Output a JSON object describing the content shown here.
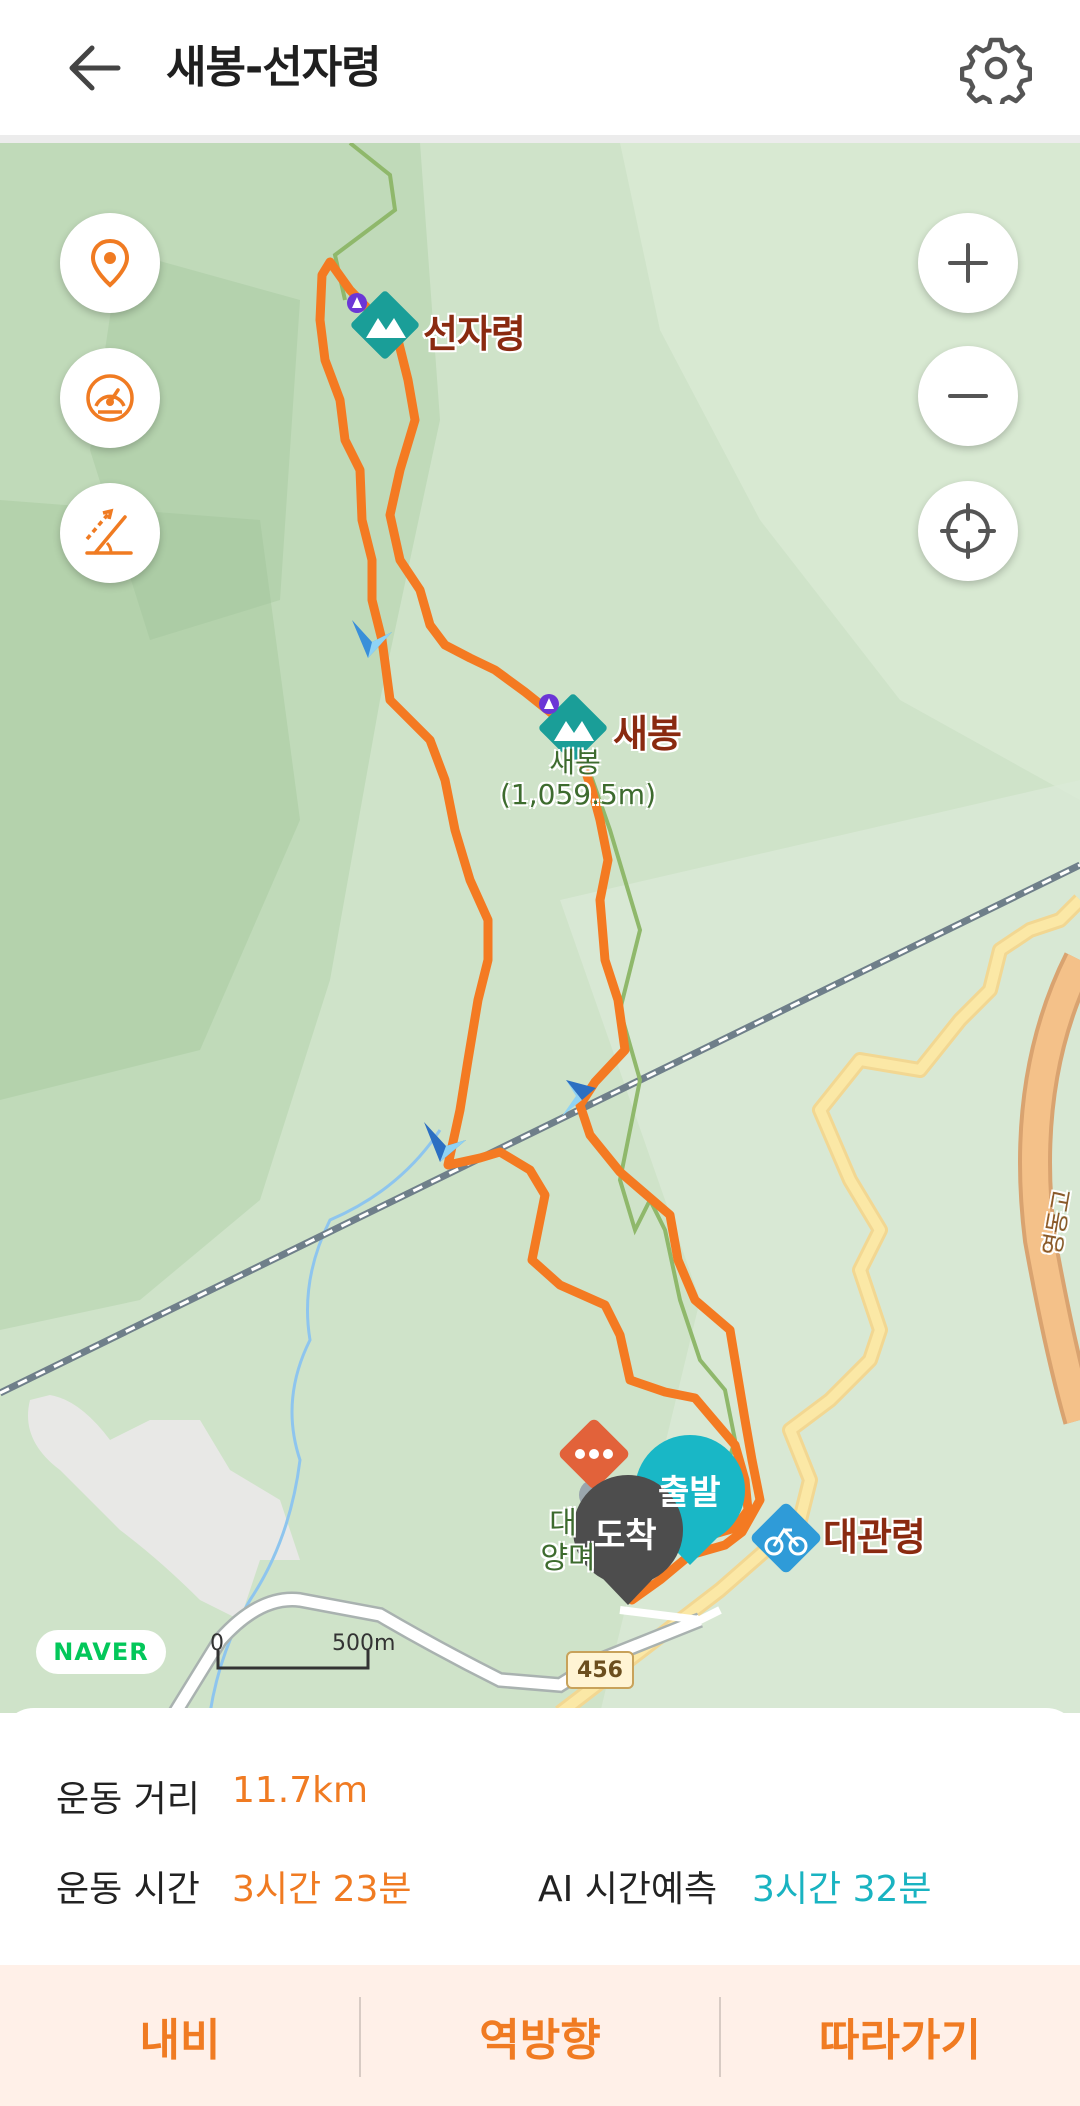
{
  "header": {
    "title": "새봉-선자령",
    "back_icon": "back-arrow-icon",
    "settings_icon": "gear-icon"
  },
  "map": {
    "labels": {
      "peak1": "선자령",
      "peak2": "새봉",
      "peak2_sub_name": "새봉",
      "peak2_sub_elev": "(1,059.5m)",
      "pass": "대관령",
      "place_a": "대",
      "place_b": "양며",
      "road_vertical": "영동고"
    },
    "pins": {
      "start": "출발",
      "end": "도착"
    },
    "attribution": "NAVER",
    "scale": {
      "zero": "0",
      "dist": "500m"
    },
    "road_number": "456",
    "left_tools": [
      "location-pin-icon",
      "speedometer-icon",
      "slope-icon"
    ],
    "right_tools": [
      "zoom-in-icon",
      "zoom-out-icon",
      "locate-me-icon"
    ]
  },
  "stats": {
    "distance_label": "운동 거리",
    "distance_value": "11.7km",
    "time_label": "운동 시간",
    "time_value": "3시간 23분",
    "ai_label": "AI 시간예측",
    "ai_value": "3시간 32분"
  },
  "actions": {
    "navi": "내비",
    "reverse": "역방향",
    "follow": "따라가기"
  },
  "colors": {
    "route": "#f47a22",
    "accent": "#f07b22",
    "ai": "#19b3c1",
    "peak_marker": "#1a9e98",
    "end_pin": "#4d4d4d",
    "start_pin": "#19b7c6"
  }
}
